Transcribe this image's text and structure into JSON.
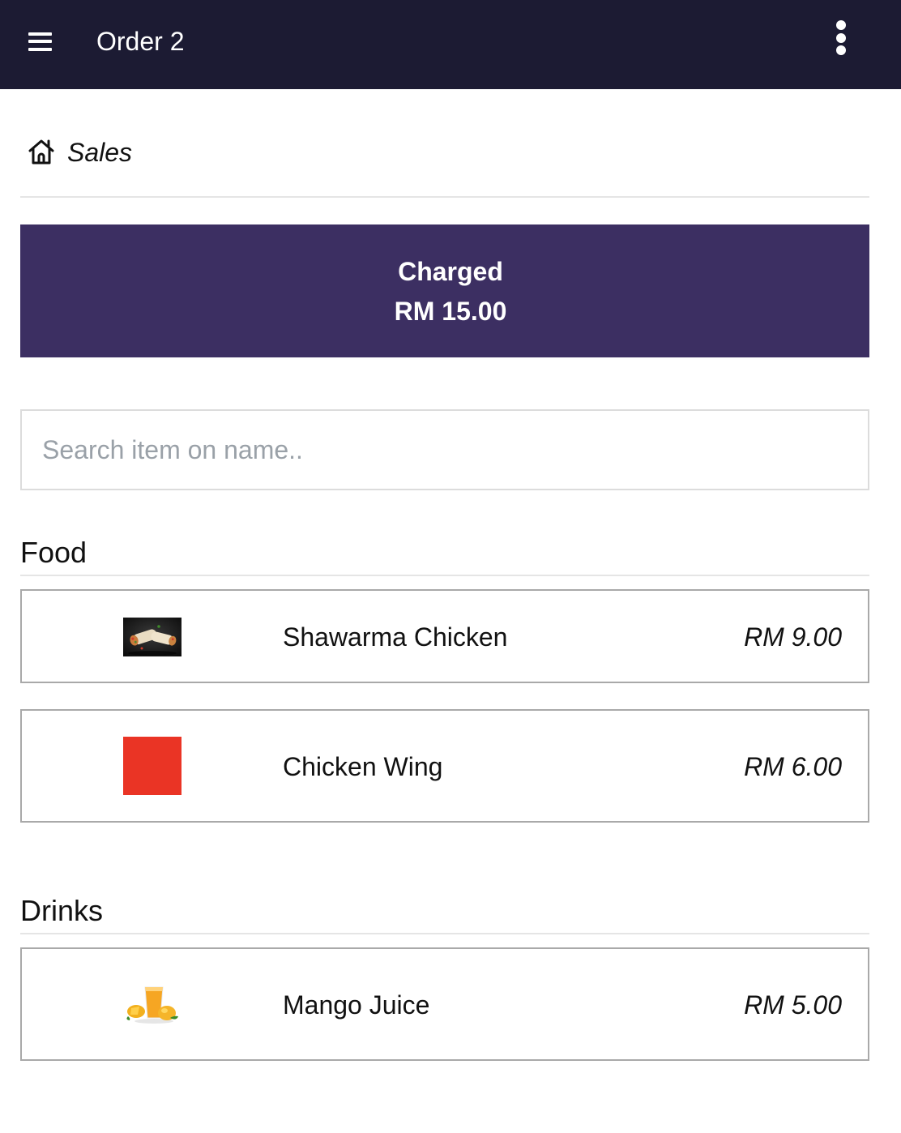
{
  "header": {
    "title": "Order 2",
    "menu_icon": "hamburger-menu-icon",
    "more_icon": "more-vertical-icon",
    "background": "#1c1b33"
  },
  "breadcrumb": {
    "icon": "home-icon",
    "label": "Sales"
  },
  "charge": {
    "label": "Charged",
    "amount": "RM 15.00",
    "color": "#3c2f62"
  },
  "search": {
    "placeholder": "Search item on name..",
    "value": ""
  },
  "sections": [
    {
      "title": "Food",
      "items": [
        {
          "name": "Shawarma Chicken",
          "price": "RM 9.00",
          "thumbnail": "shawarma-photo"
        },
        {
          "name": "Chicken Wing",
          "price": "RM 6.00",
          "thumbnail": "red-color-swatch",
          "swatch_color": "#ea3425"
        }
      ]
    },
    {
      "title": "Drinks",
      "items": [
        {
          "name": "Mango Juice",
          "price": "RM 5.00",
          "thumbnail": "mango-juice-photo"
        }
      ]
    }
  ]
}
